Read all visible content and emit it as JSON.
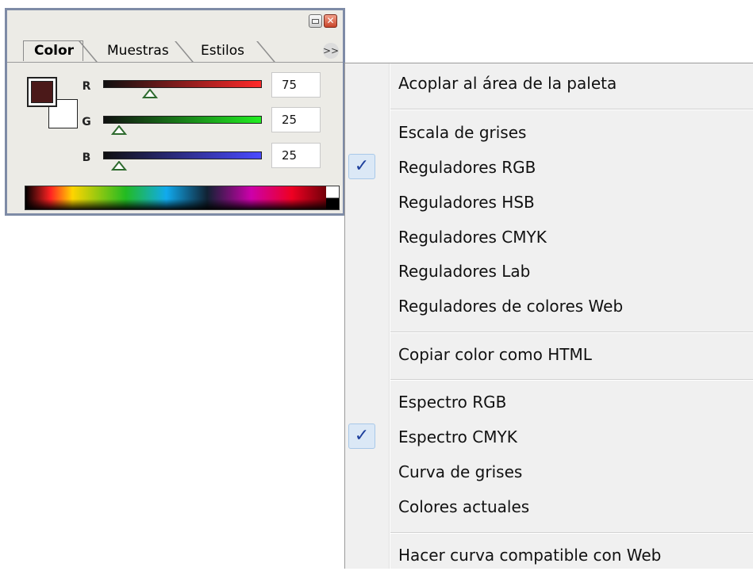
{
  "palette": {
    "tabs": [
      "Color",
      "Muestras",
      "Estilos"
    ],
    "more_icon": "double-chevron-right-icon",
    "close_glyph": "✕",
    "foreground_color": "#4b1919",
    "background_color": "#ffffff",
    "channels": [
      {
        "label": "R",
        "value": "75",
        "gradient_end": "#ff2a2a"
      },
      {
        "label": "G",
        "value": "25",
        "gradient_end": "#22ee22"
      },
      {
        "label": "B",
        "value": "25",
        "gradient_end": "#4a4aff"
      }
    ]
  },
  "menu": {
    "items": [
      {
        "label": "Acoplar al área de la paleta",
        "checked": false
      },
      {
        "label": "Escala de grises",
        "checked": false
      },
      {
        "label": "Reguladores RGB",
        "checked": true
      },
      {
        "label": "Reguladores HSB",
        "checked": false
      },
      {
        "label": "Reguladores CMYK",
        "checked": false
      },
      {
        "label": "Reguladores Lab",
        "checked": false
      },
      {
        "label": "Reguladores de colores Web",
        "checked": false
      },
      {
        "label": "Copiar color como HTML",
        "checked": false
      },
      {
        "label": "Espectro RGB",
        "checked": false
      },
      {
        "label": "Espectro CMYK",
        "checked": true
      },
      {
        "label": "Curva de grises",
        "checked": false
      },
      {
        "label": "Colores actuales",
        "checked": false
      },
      {
        "label": "Hacer curva compatible con Web",
        "checked": false
      }
    ],
    "check_glyph": "✓"
  }
}
